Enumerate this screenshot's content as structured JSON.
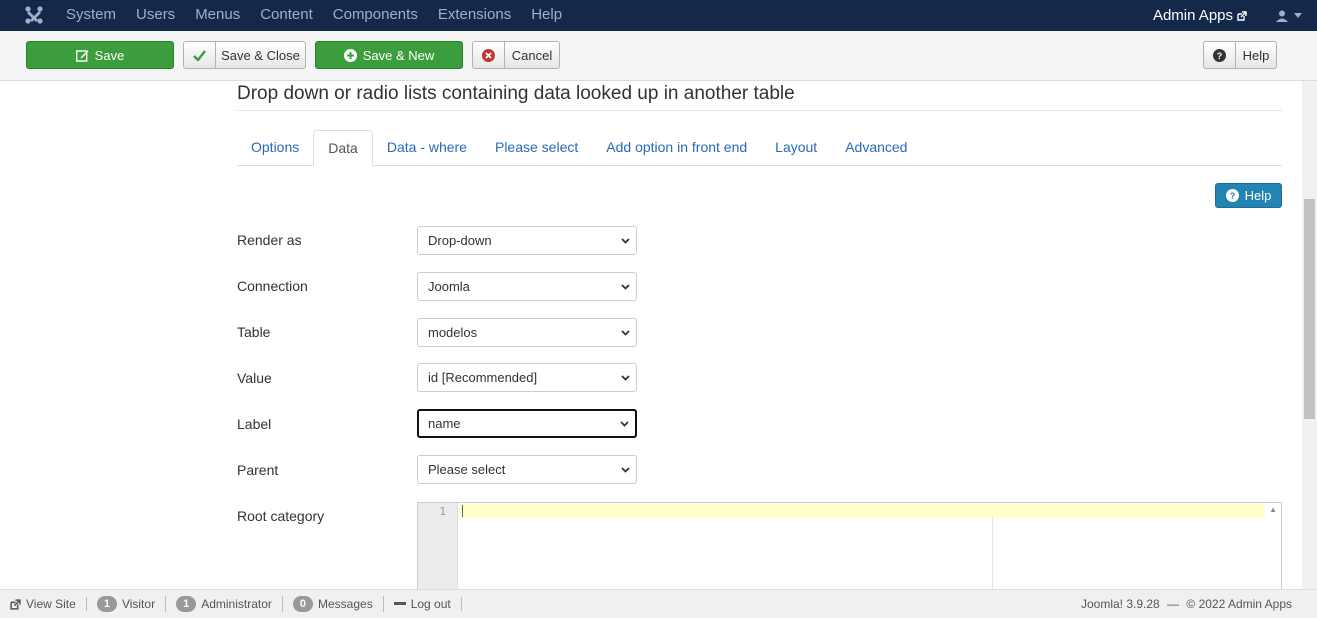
{
  "navbar": {
    "menu": [
      "System",
      "Users",
      "Menus",
      "Content",
      "Components",
      "Extensions",
      "Help"
    ],
    "site_name": "Admin Apps"
  },
  "toolbar": {
    "save": "Save",
    "save_close": "Save & Close",
    "save_new": "Save & New",
    "cancel": "Cancel",
    "help": "Help"
  },
  "page": {
    "title": "Drop down or radio lists containing data looked up in another table"
  },
  "tabs": [
    {
      "label": "Options",
      "active": false
    },
    {
      "label": "Data",
      "active": true
    },
    {
      "label": "Data - where",
      "active": false
    },
    {
      "label": "Please select",
      "active": false
    },
    {
      "label": "Add option in front end",
      "active": false
    },
    {
      "label": "Layout",
      "active": false
    },
    {
      "label": "Advanced",
      "active": false
    }
  ],
  "help_button": "Help",
  "fields": [
    {
      "label": "Render as",
      "value": "Drop-down"
    },
    {
      "label": "Connection",
      "value": "Joomla"
    },
    {
      "label": "Table",
      "value": "modelos"
    },
    {
      "label": "Value",
      "value": "id [Recommended]"
    },
    {
      "label": "Label",
      "value": "name"
    },
    {
      "label": "Parent",
      "value": "Please select"
    }
  ],
  "root_category": {
    "label": "Root category",
    "line_number": "1"
  },
  "statusbar": {
    "view_site": "View Site",
    "visitors_count": "1",
    "visitors_label": "Visitor",
    "admins_count": "1",
    "admins_label": "Administrator",
    "messages_count": "0",
    "messages_label": "Messages",
    "logout": "Log out",
    "version": "Joomla! 3.9.28",
    "separator": "—",
    "copyright": "© 2022 Admin Apps"
  },
  "colors": {
    "navbar_bg": "#142849",
    "save_green": "#3c9d3c",
    "help_blue": "#2384b3",
    "link_blue": "#2a69b8"
  }
}
